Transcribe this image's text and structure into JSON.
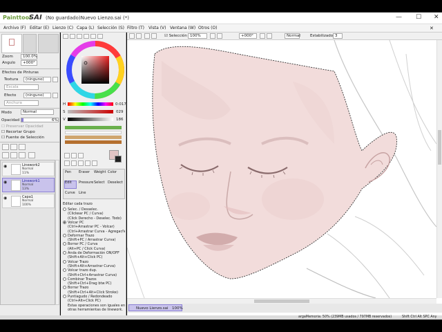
{
  "window": {
    "logo_small": "Painttool",
    "logo_big": "SAI",
    "title": "(No guardado)Nuevo Lienzo.sai (*)",
    "controls": {
      "minimize": "—",
      "maximize": "☐",
      "close": "✕"
    }
  },
  "menu": [
    "Archivo (F)",
    "Editar (E)",
    "Lienzo (C)",
    "Capa (L)",
    "Selección (S)",
    "Filtro (T)",
    "Vista (V)",
    "Ventana (W)",
    "Otros (O)"
  ],
  "nav": {
    "zoom_label": "Zoom",
    "zoom_value": "100.0%",
    "angle_label": "Angulo",
    "angle_value": "+000°"
  },
  "effects": {
    "header": "Efectos de Pinturas",
    "texture_label": "Textura",
    "texture_value": "(ninguno)",
    "texture_sub": "Escala",
    "effect_label": "Efecto",
    "effect_value": "(ninguno)",
    "effect_sub": "Anchura"
  },
  "layer_props": {
    "mode_label": "Modo",
    "mode_value": "Normal",
    "opacity_label": "Opacidad",
    "opacity_value": "6%",
    "check1": "Preservar Opacidad",
    "check2": "Recortar Grupo",
    "check3": "Fuente de Selección"
  },
  "layers": [
    {
      "name": "Linework2",
      "mode": "Normal",
      "opacity": "11%"
    },
    {
      "name": "Linework1",
      "mode": "Normal",
      "opacity": "13%",
      "selected": true
    },
    {
      "name": "Capa1",
      "mode": "Normal",
      "opacity": "100%"
    }
  ],
  "color": {
    "h_label": "H",
    "h_value": "0:017",
    "s_label": "S",
    "s_value": "029",
    "v_label": "V",
    "v_value": "186",
    "current": "#e2c4c4"
  },
  "tools": {
    "row1": [
      "Pen",
      "Eraser",
      "Weight",
      "Color"
    ],
    "row2": [
      "Edit",
      "Pressure",
      "Select",
      "Deselect"
    ],
    "row3": [
      "Curve",
      "Line"
    ]
  },
  "tool_options": {
    "header": "Editar cada trazo",
    "items": [
      {
        "label": "Selec. / Desselec.",
        "on": false
      },
      {
        "label": "(Clickear PC / Curva)",
        "sub": true
      },
      {
        "label": "(Click Derecho - Deselec. Todo)",
        "sub": true
      },
      {
        "label": "Volcar PC",
        "on": true
      },
      {
        "label": "(Ctrl+Arrastrar PC - Volcar)",
        "sub": true
      },
      {
        "label": "(Ctrl+Arrastrar Curva - Agregar/V",
        "sub": true
      },
      {
        "label": "Deformar Trazo",
        "on": false
      },
      {
        "label": "(Shift+PC / Arrastrar Curva)",
        "sub": true
      },
      {
        "label": "Borrar PC / Curva",
        "on": false
      },
      {
        "label": "(Alt+PC / Click Curva)",
        "sub": true
      },
      {
        "label": "Anda de Deformación ON/OFF",
        "on": false
      },
      {
        "label": "(Shift+Alt+Click PC)",
        "sub": true
      },
      {
        "label": "Volcar Trazo",
        "on": false
      },
      {
        "label": "(Shift+Alt+Arrastrar Curva)",
        "sub": true
      },
      {
        "label": "Volcar trazo dup.",
        "on": false
      },
      {
        "label": "(Shift+Ctrl+Arrastrar Curva)",
        "sub": true
      },
      {
        "label": "Combinar Trazos",
        "on": false
      },
      {
        "label": "(Shift+Ctrl+Drag btw PC)",
        "sub": true
      },
      {
        "label": "Borrar Trazo",
        "on": false
      },
      {
        "label": "(Shift+Ctrl+Alt+Click Stroke)",
        "sub": true
      },
      {
        "label": "Puntiagudo / Redondeado",
        "on": false
      },
      {
        "label": "(Ctrl+Alt+Click PC)",
        "sub": true
      },
      {
        "label": "Estas operaciones son iguales en",
        "sub": true
      },
      {
        "label": "otras herramientas de linework.",
        "sub": true
      }
    ]
  },
  "canvas_toolbar": {
    "selection_label": "Selección",
    "zoom": "100%",
    "angle": "+000°",
    "mode": "Normal",
    "stabilizer_label": "Estabilizador",
    "stabilizer_value": "3"
  },
  "tab": {
    "name": "Nuevo Lienzo.sai",
    "zoom": "100%"
  },
  "status": {
    "memory": "argaMemoria: 50% (239MB usados / 797MB reservados)",
    "keys": "Shift Ctrl Alt SPC Any"
  },
  "colors": {
    "selected_layer": "#c9c3ec",
    "skin": "#f2dcdb",
    "selection_dash": "#333333"
  }
}
